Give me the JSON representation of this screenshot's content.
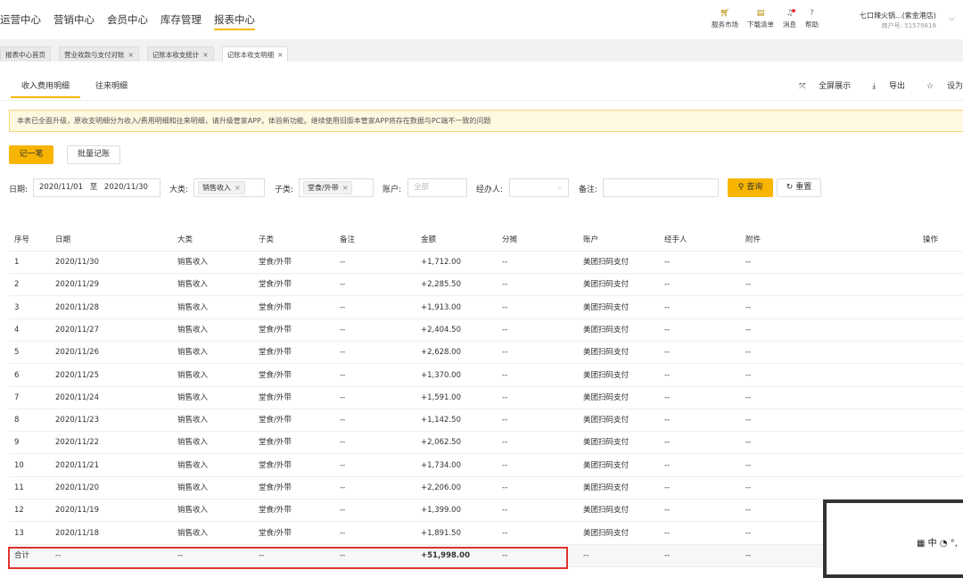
{
  "topnav": {
    "menu": [
      {
        "label": "运营中心",
        "active": false
      },
      {
        "label": "营销中心",
        "active": false
      },
      {
        "label": "会员中心",
        "active": false
      },
      {
        "label": "库存管理",
        "active": false
      },
      {
        "label": "报表中心",
        "active": true
      }
    ],
    "tools": [
      {
        "label": "服务市场",
        "icon": "shop-cart-icon"
      },
      {
        "label": "下载清单",
        "icon": "download-list-icon"
      },
      {
        "label": "消息",
        "icon": "bell-icon"
      },
      {
        "label": "帮助",
        "icon": "help-icon"
      }
    ],
    "store_name": "七口辣火锅...(紫金港店)",
    "merchant_id": "商户号: 51579819"
  },
  "tabs": [
    {
      "label": "报表中心首页",
      "closable": false
    },
    {
      "label": "营业收款与支付对账",
      "closable": true
    },
    {
      "label": "记账本收支统计",
      "closable": true
    },
    {
      "label": "记账本收支明细",
      "closable": true,
      "active": true
    }
  ],
  "subtabs": {
    "items": [
      "收入费用明细",
      "往来明细"
    ],
    "actions": [
      "全屏展示",
      "导出",
      "设为"
    ]
  },
  "notice": "本表已全面升级，原收支明细分为收入/费用明细和往来明细，请升级管家APP，体验新功能。继续使用旧版本管家APP将存在数据与PC端不一致的问题",
  "buttons": {
    "record": "记一笔",
    "batch": "批量记账",
    "query": "查询",
    "reset": "重置"
  },
  "filters": {
    "date_label": "日期:",
    "date_from": "2020/11/01",
    "date_to_word": "至",
    "date_to": "2020/11/30",
    "category_label": "大类:",
    "category_value": "销售收入",
    "subcategory_label": "子类:",
    "subcategory_value": "堂食/外带",
    "account_label": "账户:",
    "account_placeholder": "全部",
    "handler_label": "经办人:",
    "remark_label": "备注:"
  },
  "table": {
    "headers": [
      "序号",
      "日期",
      "大类",
      "子类",
      "备注",
      "金额",
      "分摊",
      "账户",
      "经手人",
      "附件",
      "操作"
    ],
    "rows": [
      [
        "1",
        "2020/11/30",
        "销售收入",
        "堂食/外带",
        "--",
        "+1,712.00",
        "--",
        "美团扫码支付",
        "--",
        "--"
      ],
      [
        "2",
        "2020/11/29",
        "销售收入",
        "堂食/外带",
        "--",
        "+2,285.50",
        "--",
        "美团扫码支付",
        "--",
        "--"
      ],
      [
        "3",
        "2020/11/28",
        "销售收入",
        "堂食/外带",
        "--",
        "+1,913.00",
        "--",
        "美团扫码支付",
        "--",
        "--"
      ],
      [
        "4",
        "2020/11/27",
        "销售收入",
        "堂食/外带",
        "--",
        "+2,404.50",
        "--",
        "美团扫码支付",
        "--",
        "--"
      ],
      [
        "5",
        "2020/11/26",
        "销售收入",
        "堂食/外带",
        "--",
        "+2,628.00",
        "--",
        "美团扫码支付",
        "--",
        "--"
      ],
      [
        "6",
        "2020/11/25",
        "销售收入",
        "堂食/外带",
        "--",
        "+1,370.00",
        "--",
        "美团扫码支付",
        "--",
        "--"
      ],
      [
        "7",
        "2020/11/24",
        "销售收入",
        "堂食/外带",
        "--",
        "+1,591.00",
        "--",
        "美团扫码支付",
        "--",
        "--"
      ],
      [
        "8",
        "2020/11/23",
        "销售收入",
        "堂食/外带",
        "--",
        "+1,142.50",
        "--",
        "美团扫码支付",
        "--",
        "--"
      ],
      [
        "9",
        "2020/11/22",
        "销售收入",
        "堂食/外带",
        "--",
        "+2,062.50",
        "--",
        "美团扫码支付",
        "--",
        "--"
      ],
      [
        "10",
        "2020/11/21",
        "销售收入",
        "堂食/外带",
        "--",
        "+1,734.00",
        "--",
        "美团扫码支付",
        "--",
        "--"
      ],
      [
        "11",
        "2020/11/20",
        "销售收入",
        "堂食/外带",
        "--",
        "+2,206.00",
        "--",
        "美团扫码支付",
        "--",
        "--"
      ],
      [
        "12",
        "2020/11/19",
        "销售收入",
        "堂食/外带",
        "--",
        "+1,399.00",
        "--",
        "美团扫码支付",
        "--",
        "--"
      ],
      [
        "13",
        "2020/11/18",
        "销售收入",
        "堂食/外带",
        "--",
        "+1,891.50",
        "--",
        "美团扫码支付",
        "--",
        "--"
      ]
    ],
    "summary": [
      "合计",
      "--",
      "--",
      "--",
      "--",
      "+51,998.00",
      "--",
      "--",
      "--",
      "--"
    ]
  },
  "ime_text": "中 ◔ °,",
  "colors": {
    "accent": "#f7b500",
    "highlight": "#e0322c",
    "notice_bg": "#fff8e0"
  }
}
